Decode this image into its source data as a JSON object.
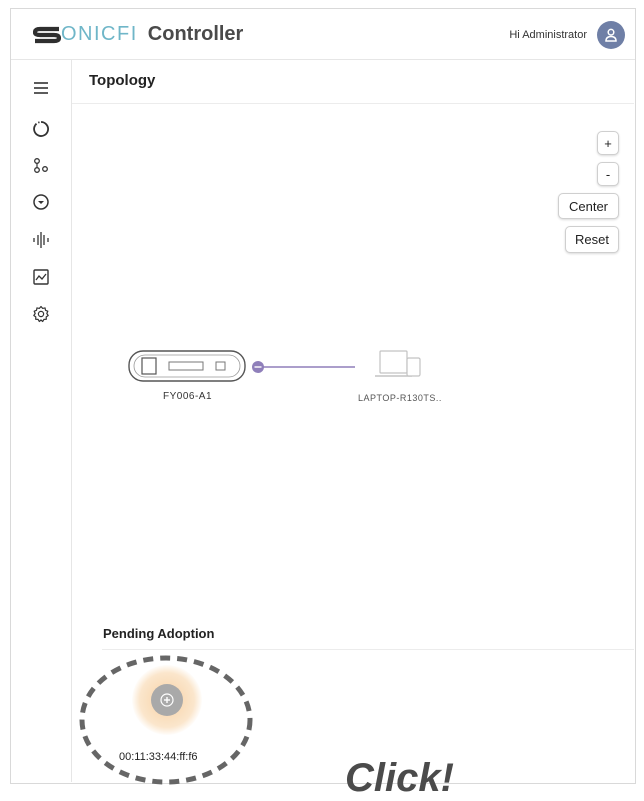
{
  "header": {
    "logo_text": "ONICFI",
    "app_title": "Controller",
    "greeting": "Hi Administrator",
    "avatar_icon": "user-icon"
  },
  "sidebar": {
    "items": [
      {
        "icon": "menu-icon"
      },
      {
        "icon": "dashboard-icon"
      },
      {
        "icon": "topology-icon"
      },
      {
        "icon": "device-icon"
      },
      {
        "icon": "audio-signal-icon"
      },
      {
        "icon": "statistics-icon"
      },
      {
        "icon": "settings-icon"
      }
    ]
  },
  "main": {
    "title": "Topology",
    "controls": {
      "zoom_in": "+",
      "zoom_out": "-",
      "center": "Center",
      "reset": "Reset"
    },
    "nodes": {
      "gateway_label": "FY006-A1",
      "client_label": "LAPTOP-R130TS.."
    },
    "pending": {
      "title": "Pending Adoption",
      "device_mac": "00:11:33:44:ff:f6"
    },
    "click_hint": "Click!"
  },
  "colors": {
    "accent": "#8f7fba",
    "logo": "#6fb6c8",
    "avatar": "#6f7fa6",
    "pending_glow": "#f7d1a3"
  }
}
